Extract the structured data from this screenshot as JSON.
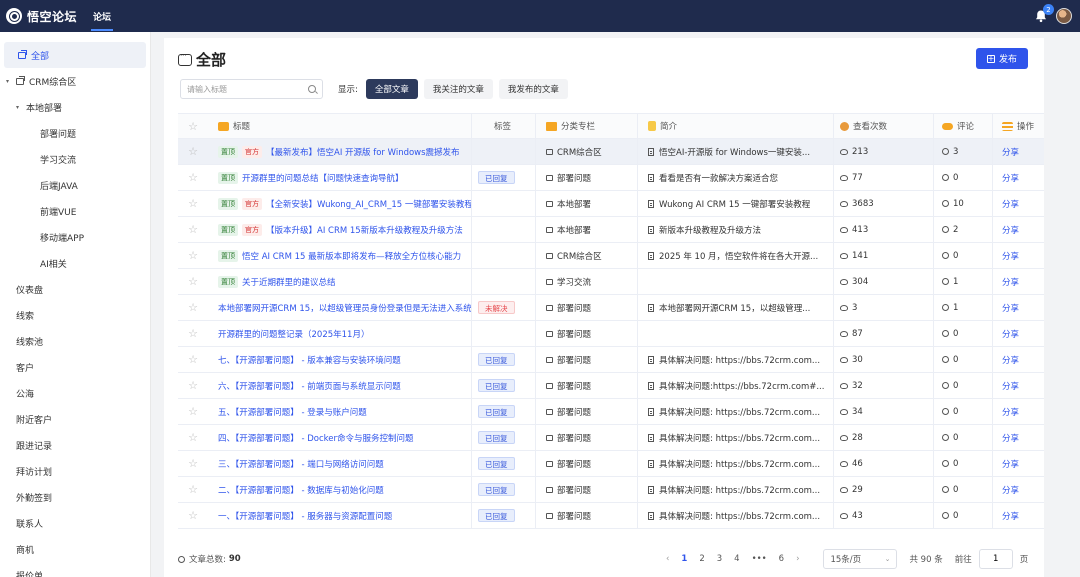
{
  "app": {
    "title": "悟空论坛",
    "nav_tab": "论坛",
    "notification_count": "2"
  },
  "sidebar": {
    "items": [
      {
        "label": "全部",
        "level": 0,
        "active": true,
        "icon": "folder-icon"
      },
      {
        "label": "CRM综合区",
        "level": 0,
        "caret": "▾",
        "icon": "folder-icon"
      },
      {
        "label": "本地部署",
        "level": 1,
        "caret": "▾"
      },
      {
        "label": "部署问题",
        "level": 2
      },
      {
        "label": "学习交流",
        "level": 2
      },
      {
        "label": "后端JAVA",
        "level": 2
      },
      {
        "label": "前端VUE",
        "level": 2
      },
      {
        "label": "移动端APP",
        "level": 2
      },
      {
        "label": "AI相关",
        "level": 2
      },
      {
        "label": "仪表盘",
        "level": 1
      },
      {
        "label": "线索",
        "level": 1
      },
      {
        "label": "线索池",
        "level": 1
      },
      {
        "label": "客户",
        "level": 1
      },
      {
        "label": "公海",
        "level": 1
      },
      {
        "label": "附近客户",
        "level": 1
      },
      {
        "label": "跟进记录",
        "level": 1
      },
      {
        "label": "拜访计划",
        "level": 1
      },
      {
        "label": "外勤签到",
        "level": 1
      },
      {
        "label": "联系人",
        "level": 1
      },
      {
        "label": "商机",
        "level": 1
      },
      {
        "label": "报价单",
        "level": 1
      }
    ]
  },
  "main": {
    "page_title": "全部",
    "publish_label": "发布",
    "search": {
      "placeholder": "请输入标题",
      "value": ""
    },
    "show_label": "显示:",
    "filter_tabs": [
      {
        "label": "全部文章",
        "active": true
      },
      {
        "label": "我关注的文章",
        "active": false
      },
      {
        "label": "我发布的文章",
        "active": false
      }
    ]
  },
  "table": {
    "headers": {
      "title": "标题",
      "tag": "标签",
      "category": "分类专栏",
      "intro": "简介",
      "views": "查看次数",
      "comments": "评论",
      "actions": "操作"
    },
    "rows": [
      {
        "top": "置顶",
        "official": "官方",
        "title": "【最新发布】悟空AI 开源版 for Windows震撼发布",
        "tag": "",
        "category": "CRM综合区",
        "intro": "悟空AI-开源版 for Windows一键安装...",
        "views": "213",
        "comments": "3",
        "action": "分享",
        "highlight": true
      },
      {
        "top": "置顶",
        "official": "",
        "title": "开源群里的问题总结【问题快速查询导航】",
        "tag": "已回复",
        "category": "部署问题",
        "intro": "看看是否有一款解决方案适合您",
        "views": "77",
        "comments": "0",
        "action": "分享"
      },
      {
        "top": "置顶",
        "official": "官方",
        "title": "【全新安装】Wukong_AI_CRM_15 一键部署安装教程",
        "tag": "",
        "category": "本地部署",
        "intro": "Wukong  AI  CRM  15 一键部署安装教程",
        "views": "3683",
        "comments": "10",
        "action": "分享"
      },
      {
        "top": "置顶",
        "official": "官方",
        "title": "【版本升级】AI CRM 15新版本升级教程及升级方法",
        "tag": "",
        "category": "本地部署",
        "intro": "新版本升级教程及升级方法",
        "views": "413",
        "comments": "2",
        "action": "分享"
      },
      {
        "top": "置顶",
        "official": "",
        "title": "悟空 AI CRM 15 最新版本即将发布—释放全方位核心能力",
        "tag": "",
        "category": "CRM综合区",
        "intro": "2025 年 10 月，悟空软件将在各大开源...",
        "views": "141",
        "comments": "0",
        "action": "分享"
      },
      {
        "top": "置顶",
        "official": "",
        "title": "关于近期群里的建议总结",
        "tag": "",
        "category": "学习交流",
        "intro": "",
        "views": "304",
        "comments": "1",
        "action": "分享"
      },
      {
        "top": "",
        "official": "",
        "title": "本地部署网开源CRM 15，以超级管理员身份登录但是无法进入系统",
        "tag": "未解决",
        "category": "部署问题",
        "intro": "本地部署网开源CRM 15，以超级管理...",
        "views": "3",
        "comments": "1",
        "action": "分享"
      },
      {
        "top": "",
        "official": "",
        "title": "开源群里的问题整记录（2025年11月）",
        "tag": "",
        "category": "部署问题",
        "intro": "",
        "views": "87",
        "comments": "0",
        "action": "分享"
      },
      {
        "top": "",
        "official": "",
        "title": "七、【开源部署问题】 - 版本兼容与安装环境问题",
        "tag": "已回复",
        "category": "部署问题",
        "intro": "具体解决问题: https://bbs.72crm.com...",
        "views": "30",
        "comments": "0",
        "action": "分享"
      },
      {
        "top": "",
        "official": "",
        "title": "六、【开源部署问题】 - 前端页面与系统显示问题",
        "tag": "已回复",
        "category": "部署问题",
        "intro": "具体解决问题:https://bbs.72crm.com#...",
        "views": "32",
        "comments": "0",
        "action": "分享"
      },
      {
        "top": "",
        "official": "",
        "title": "五、【开源部署问题】 - 登录与账户问题",
        "tag": "已回复",
        "category": "部署问题",
        "intro": "具体解决问题: https://bbs.72crm.com...",
        "views": "34",
        "comments": "0",
        "action": "分享"
      },
      {
        "top": "",
        "official": "",
        "title": "四、【开源部署问题】 - Docker命令与服务控制问题",
        "tag": "已回复",
        "category": "部署问题",
        "intro": "具体解决问题: https://bbs.72crm.com...",
        "views": "28",
        "comments": "0",
        "action": "分享"
      },
      {
        "top": "",
        "official": "",
        "title": "三、【开源部署问题】 - 端口与网络访问问题",
        "tag": "已回复",
        "category": "部署问题",
        "intro": "具体解决问题: https://bbs.72crm.com...",
        "views": "46",
        "comments": "0",
        "action": "分享"
      },
      {
        "top": "",
        "official": "",
        "title": "二、【开源部署问题】 - 数据库与初始化问题",
        "tag": "已回复",
        "category": "部署问题",
        "intro": "具体解决问题: https://bbs.72crm.com...",
        "views": "29",
        "comments": "0",
        "action": "分享"
      },
      {
        "top": "",
        "official": "",
        "title": "一、【开源部署问题】 - 服务器与资源配置问题",
        "tag": "已回复",
        "category": "部署问题",
        "intro": "具体解决问题: https://bbs.72crm.com...",
        "views": "43",
        "comments": "0",
        "action": "分享"
      }
    ]
  },
  "footer": {
    "total_label": "文章总数:",
    "total_value": "90",
    "pages": [
      "1",
      "2",
      "3",
      "4",
      "•••",
      "6"
    ],
    "current_page": "1",
    "page_size": "15条/页",
    "total_items": "共 90 条",
    "goto_label": "前往",
    "goto_value": "1",
    "page_unit": "页"
  },
  "colors": {
    "topbar": "#1f2b4d",
    "accent": "#2f54eb",
    "replied": "#3b5bdb",
    "unsolved": "#e5484d",
    "top_badge": "#2e7d32"
  }
}
